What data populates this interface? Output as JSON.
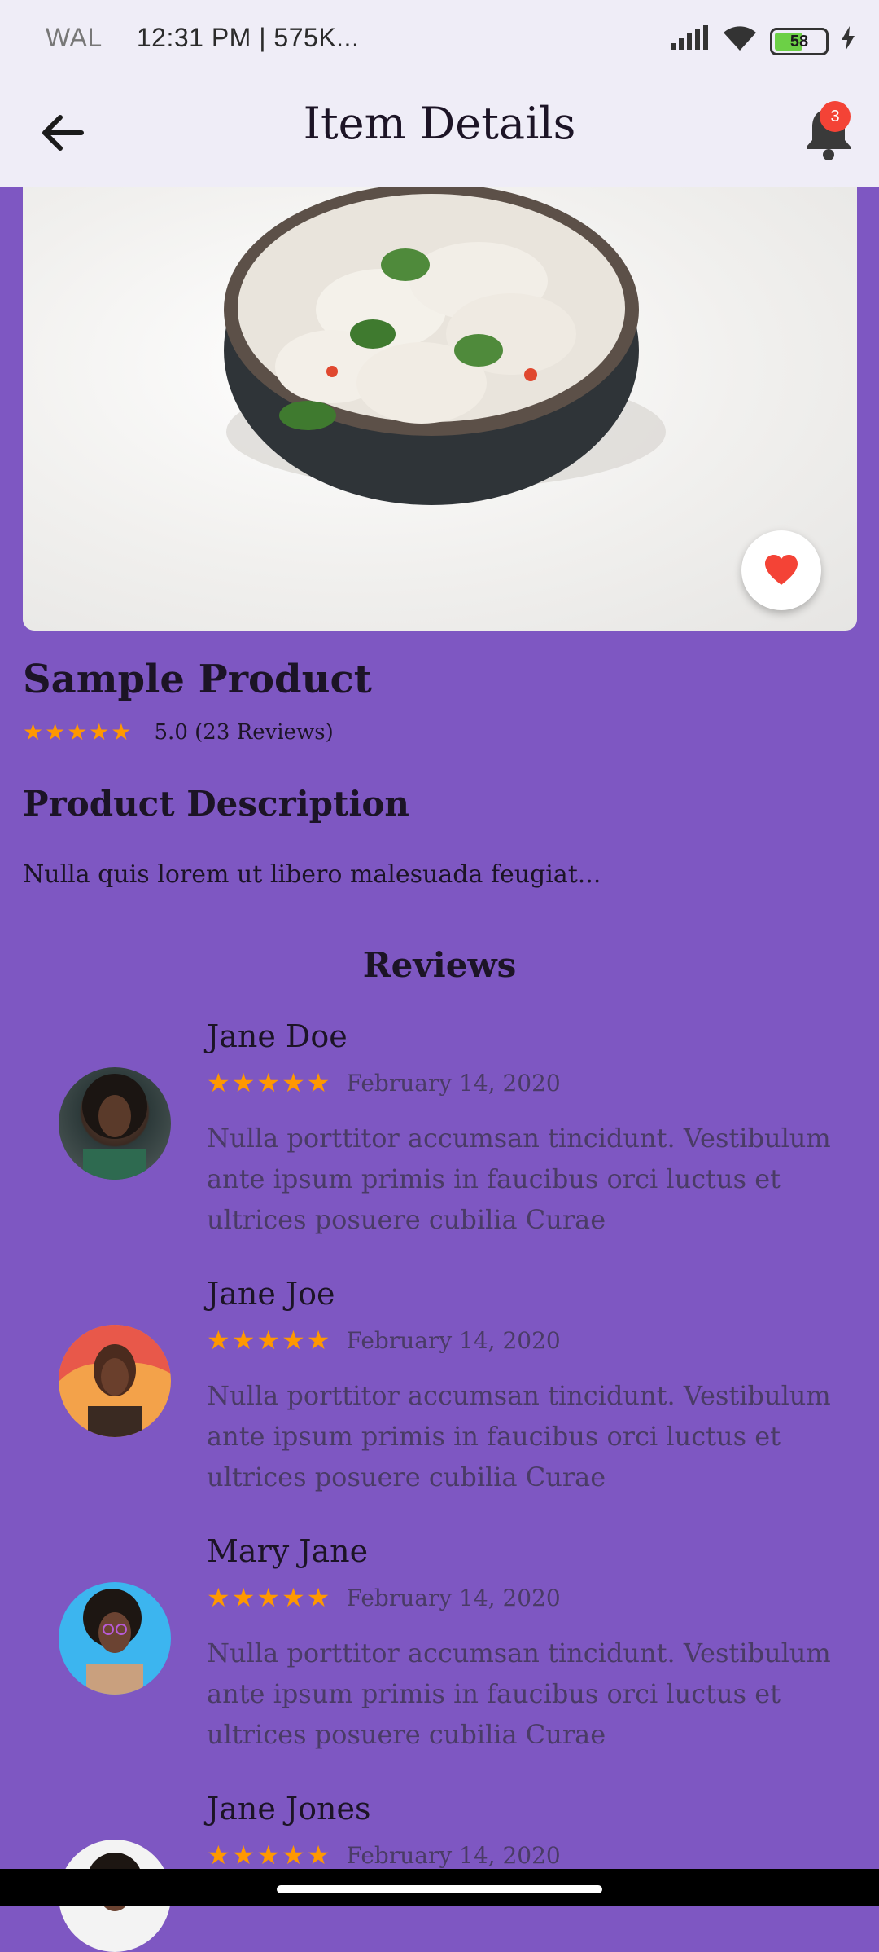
{
  "status_bar": {
    "carrier": "WAL",
    "time_info": "12:31 PM | 575K...",
    "battery": "58"
  },
  "app_bar": {
    "title": "Item Details",
    "notification_count": "3"
  },
  "product": {
    "name": "Sample Product",
    "stars": "★★★★★",
    "rating_text": "5.0 (23 Reviews)",
    "description_heading": "Product Description",
    "description": "Nulla quis lorem ut libero malesuada feugiat..."
  },
  "reviews_heading": "Reviews",
  "reviews": [
    {
      "name": "Jane Doe",
      "stars": "★★★★★",
      "date": "February 14, 2020",
      "text": "Nulla porttitor accumsan tincidunt. Vestibulum ante ipsum primis in faucibus orci luctus et ultrices posuere cubilia Curae"
    },
    {
      "name": "Jane Joe",
      "stars": "★★★★★",
      "date": "February 14, 2020",
      "text": "Nulla porttitor accumsan tincidunt. Vestibulum ante ipsum primis in faucibus orci luctus et ultrices posuere cubilia Curae"
    },
    {
      "name": "Mary Jane",
      "stars": "★★★★★",
      "date": "February 14, 2020",
      "text": "Nulla porttitor accumsan tincidunt. Vestibulum ante ipsum primis in faucibus orci luctus et ultrices posuere cubilia Curae"
    },
    {
      "name": "Jane Jones",
      "stars": "★★★★★",
      "date": "February 14, 2020",
      "text": ""
    }
  ],
  "colors": {
    "background": "#7e57c2",
    "app_bar": "#efedf7",
    "star": "#ff9800",
    "heart": "#f44336"
  }
}
